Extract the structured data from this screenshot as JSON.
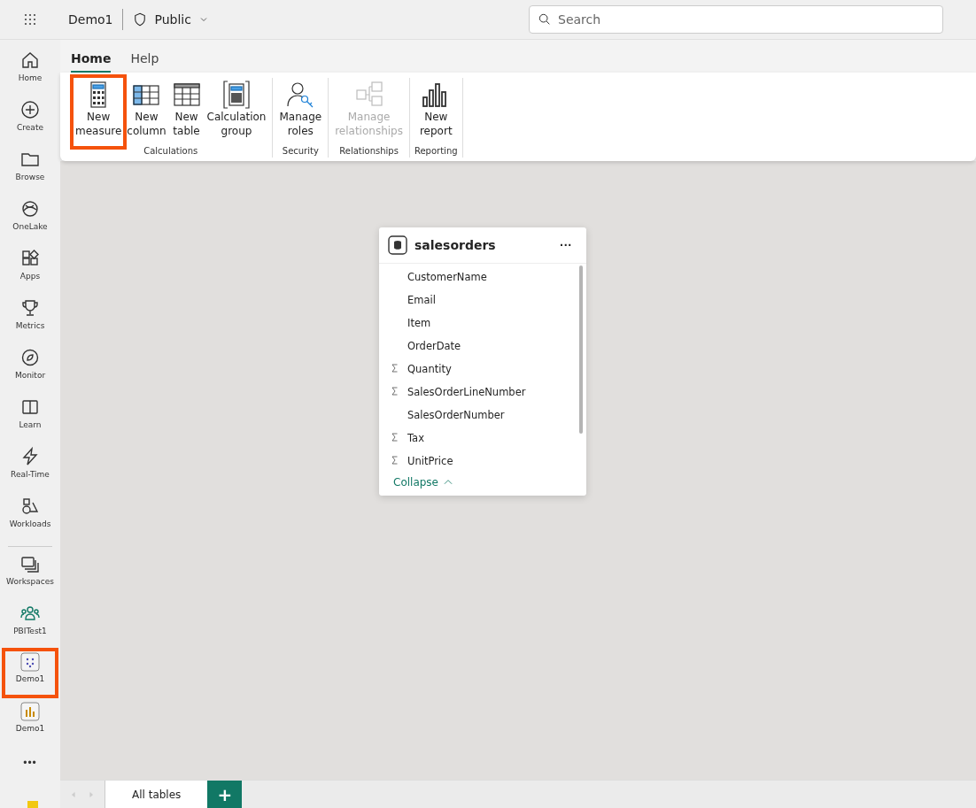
{
  "top_bar": {
    "workspace": "Demo1",
    "sensitivity": "Public",
    "search": {
      "placeholder": "Search"
    }
  },
  "nav": [
    {
      "label": "Home",
      "kind": "home",
      "highlighted": false
    },
    {
      "label": "Create",
      "kind": "create",
      "highlighted": false
    },
    {
      "label": "Browse",
      "kind": "browse",
      "highlighted": false
    },
    {
      "label": "OneLake",
      "kind": "onelake",
      "highlighted": false
    },
    {
      "label": "Apps",
      "kind": "apps",
      "highlighted": false
    },
    {
      "label": "Metrics",
      "kind": "metrics",
      "highlighted": false
    },
    {
      "label": "Monitor",
      "kind": "monitor",
      "highlighted": false
    },
    {
      "label": "Learn",
      "kind": "learn",
      "highlighted": false
    },
    {
      "label": "Real-Time",
      "kind": "realtime",
      "highlighted": false
    },
    {
      "label": "Workloads",
      "kind": "workloads",
      "highlighted": false
    },
    {
      "label": "Workspaces",
      "kind": "workspaces",
      "highlighted": false
    },
    {
      "label": "PBITest1",
      "kind": "people",
      "highlighted": false
    },
    {
      "label": "Demo1",
      "kind": "model",
      "highlighted": true
    },
    {
      "label": "Demo1",
      "kind": "report",
      "highlighted": false
    }
  ],
  "nav_more": "•••",
  "ribbon_tabs": [
    {
      "label": "Home",
      "selected": true
    },
    {
      "label": "Help",
      "selected": false
    }
  ],
  "ribbon_groups": [
    {
      "label": "Calculations",
      "buttons": [
        {
          "label": "New measure",
          "kind": "calculator",
          "disabled": false,
          "highlighted": true
        },
        {
          "label": "New column",
          "kind": "column",
          "disabled": false,
          "highlighted": false
        },
        {
          "label": "New table",
          "kind": "table",
          "disabled": false,
          "highlighted": false
        },
        {
          "label": "Calculation group",
          "kind": "calcgroup",
          "disabled": false,
          "highlighted": false
        }
      ]
    },
    {
      "label": "Security",
      "buttons": [
        {
          "label": "Manage roles",
          "kind": "roles",
          "disabled": false,
          "highlighted": false
        }
      ]
    },
    {
      "label": "Relationships",
      "buttons": [
        {
          "label": "Manage relationships",
          "kind": "relationships",
          "disabled": true,
          "highlighted": false
        }
      ]
    },
    {
      "label": "Reporting",
      "buttons": [
        {
          "label": "New report",
          "kind": "report",
          "disabled": false,
          "highlighted": false
        }
      ]
    }
  ],
  "table_card": {
    "title": "salesorders",
    "menu": "···",
    "fields": [
      {
        "name": "CustomerName",
        "kind": "text"
      },
      {
        "name": "Email",
        "kind": "text"
      },
      {
        "name": "Item",
        "kind": "text"
      },
      {
        "name": "OrderDate",
        "kind": "text"
      },
      {
        "name": "Quantity",
        "kind": "sum"
      },
      {
        "name": "SalesOrderLineNumber",
        "kind": "sum"
      },
      {
        "name": "SalesOrderNumber",
        "kind": "text"
      },
      {
        "name": "Tax",
        "kind": "sum"
      },
      {
        "name": "UnitPrice",
        "kind": "sum"
      }
    ],
    "collapse": "Collapse"
  },
  "bottom_tabs": [
    {
      "label": "All tables",
      "selected": true
    }
  ],
  "add_tab": "+"
}
